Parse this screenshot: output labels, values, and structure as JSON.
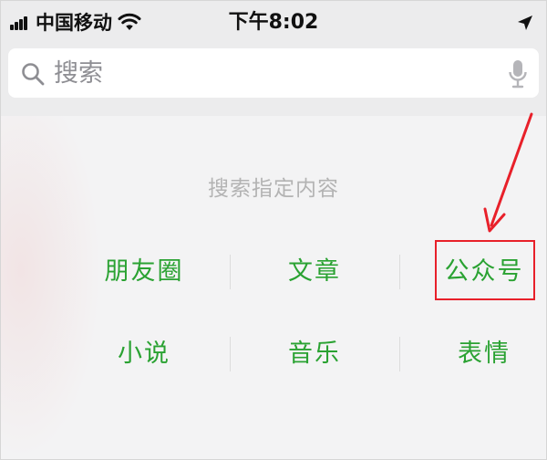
{
  "status_bar": {
    "carrier": "中国移动",
    "time": "下午8:02",
    "icons": [
      "signal-icon",
      "wifi-icon",
      "location-arrow-icon"
    ]
  },
  "search": {
    "placeholder": "搜索",
    "value": "",
    "icons": [
      "search-icon",
      "microphone-icon"
    ]
  },
  "hint": "搜索指定内容",
  "categories": [
    {
      "label": "朋友圈"
    },
    {
      "label": "文章"
    },
    {
      "label": "公众号",
      "highlighted": true
    },
    {
      "label": "小说"
    },
    {
      "label": "音乐"
    },
    {
      "label": "表情"
    }
  ],
  "colors": {
    "accent_green": "#2aa232",
    "highlight_red": "#e8202a",
    "hint_gray": "#b3b3b3",
    "background": "#f3f3f4"
  }
}
